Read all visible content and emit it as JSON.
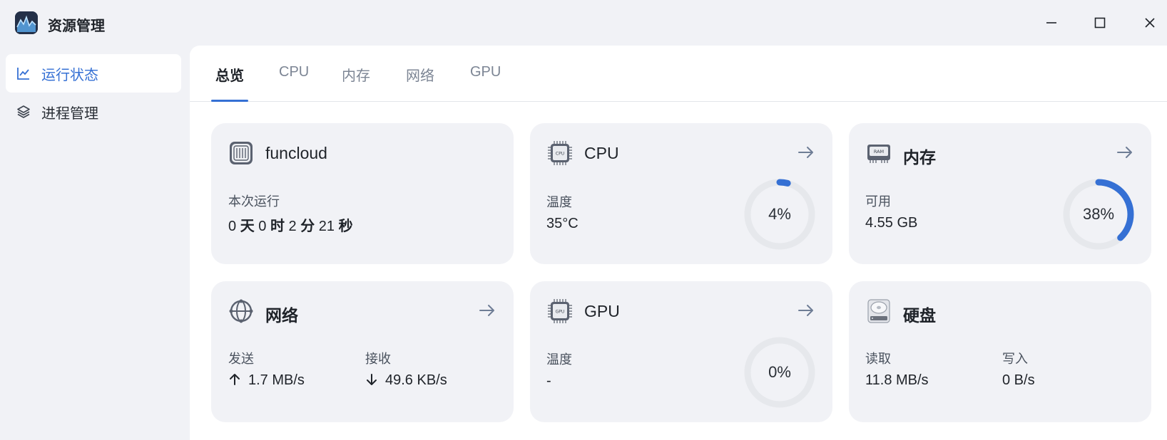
{
  "window": {
    "title": "资源管理",
    "icon": "app-monitor-icon"
  },
  "sidebar": {
    "items": [
      {
        "label": "运行状态",
        "icon": "line-chart-icon",
        "active": true
      },
      {
        "label": "进程管理",
        "icon": "layers-icon",
        "active": false
      }
    ]
  },
  "tabs": [
    {
      "label": "总览",
      "active": true
    },
    {
      "label": "CPU",
      "active": false
    },
    {
      "label": "内存",
      "active": false
    },
    {
      "label": "网络",
      "active": false
    },
    {
      "label": "GPU",
      "active": false
    }
  ],
  "cards": {
    "system": {
      "title": "funcloud",
      "uptime_label": "本次运行",
      "uptime": {
        "days": "0",
        "days_unit": "天",
        "hours": "0",
        "hours_unit": "时",
        "minutes": "2",
        "minutes_unit": "分",
        "seconds": "21",
        "seconds_unit": "秒"
      }
    },
    "cpu": {
      "title": "CPU",
      "icon_text": "CPU",
      "temp_label": "温度",
      "temp_value": "35°C",
      "usage_text": "4%",
      "usage_fraction": 0.04
    },
    "memory": {
      "title": "内存",
      "icon_text": "RAM",
      "avail_label": "可用",
      "avail_value": "4.55 GB",
      "usage_text": "38%",
      "usage_fraction": 0.38
    },
    "network": {
      "title": "网络",
      "send_label": "发送",
      "send_value": "1.7 MB/s",
      "recv_label": "接收",
      "recv_value": "49.6 KB/s"
    },
    "gpu": {
      "title": "GPU",
      "icon_text": "GPU",
      "temp_label": "温度",
      "temp_value": "-",
      "usage_text": "0%",
      "usage_fraction": 0
    },
    "disk": {
      "title": "硬盘",
      "read_label": "读取",
      "read_value": "11.8 MB/s",
      "write_label": "写入",
      "write_value": "0 B/s"
    }
  },
  "colors": {
    "accent": "#3570d4",
    "gauge_track": "#e6e8ec",
    "card_bg": "#f1f2f6"
  }
}
